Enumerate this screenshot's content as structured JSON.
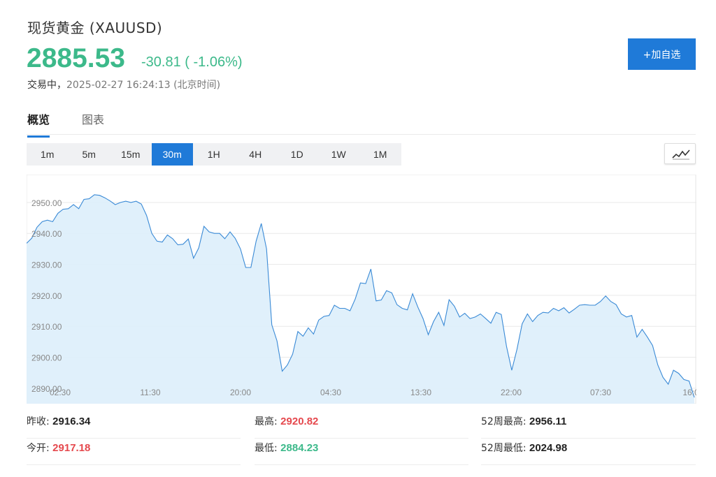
{
  "header": {
    "title": "现货黄金  (XAUUSD)",
    "price": "2885.53",
    "change": "-30.81 ( -1.06%)",
    "status_label": "交易中，",
    "timestamp": "2025-02-27 16:24:13",
    "timezone": "(北京时间)",
    "add_button": "+加自选"
  },
  "tabs": [
    {
      "label": "概览",
      "active": true
    },
    {
      "label": "图表",
      "active": false
    }
  ],
  "periods": [
    {
      "label": "1m",
      "active": false
    },
    {
      "label": "5m",
      "active": false
    },
    {
      "label": "15m",
      "active": false
    },
    {
      "label": "30m",
      "active": true
    },
    {
      "label": "1H",
      "active": false
    },
    {
      "label": "4H",
      "active": false
    },
    {
      "label": "1D",
      "active": false
    },
    {
      "label": "1W",
      "active": false
    },
    {
      "label": "1M",
      "active": false
    }
  ],
  "icons": {
    "chart_toggle": "line-chart-icon"
  },
  "colors": {
    "down": "#3cb98a",
    "up": "#e5484d",
    "accent": "#1f7ad8",
    "line": "#3a8ad6",
    "fill": "#ddeefb"
  },
  "chart_data": {
    "type": "area",
    "x_ticks": [
      "02:30",
      "11:30",
      "20:00",
      "04:30",
      "13:30",
      "22:00",
      "07:30",
      "16:0"
    ],
    "y_ticks": [
      "2950.00",
      "2940.00",
      "2930.00",
      "2920.00",
      "2910.00",
      "2900.00",
      "2890.00"
    ],
    "ylim": [
      2885.0,
      2959.0
    ],
    "values": [
      2936.8,
      2938.5,
      2942.0,
      2943.8,
      2944.3,
      2943.8,
      2946.5,
      2947.8,
      2948.0,
      2949.3,
      2948.0,
      2951.0,
      2951.2,
      2952.5,
      2952.3,
      2951.5,
      2950.5,
      2949.3,
      2950.0,
      2950.4,
      2950.0,
      2950.4,
      2949.5,
      2945.8,
      2940.0,
      2937.5,
      2937.2,
      2939.5,
      2938.3,
      2936.3,
      2936.5,
      2938.2,
      2932.0,
      2935.3,
      2942.3,
      2940.5,
      2940.0,
      2940.0,
      2938.3,
      2940.5,
      2938.4,
      2935.0,
      2929.0,
      2929.0,
      2937.5,
      2943.2,
      2935.0,
      2910.5,
      2905.3,
      2895.5,
      2897.5,
      2901.0,
      2908.3,
      2906.8,
      2909.5,
      2907.5,
      2912.0,
      2913.2,
      2913.5,
      2916.8,
      2915.8,
      2915.8,
      2915.0,
      2918.8,
      2924.0,
      2923.8,
      2928.5,
      2918.2,
      2918.5,
      2921.5,
      2920.8,
      2917.0,
      2915.8,
      2915.3,
      2920.5,
      2916.2,
      2912.5,
      2907.3,
      2911.5,
      2914.5,
      2910.3,
      2918.6,
      2916.5,
      2913.0,
      2914.2,
      2912.5,
      2913.0,
      2914.0,
      2912.5,
      2911.0,
      2914.5,
      2913.8,
      2903.5,
      2895.8,
      2902.5,
      2910.8,
      2914.0,
      2911.5,
      2913.5,
      2914.5,
      2914.3,
      2915.8,
      2915.0,
      2916.0,
      2914.3,
      2915.5,
      2916.8,
      2917.0,
      2916.8,
      2916.8,
      2918.0,
      2919.8,
      2918.0,
      2917.0,
      2914.0,
      2913.0,
      2913.5,
      2906.5,
      2909.0,
      2906.5,
      2903.8,
      2897.5,
      2893.5,
      2891.3,
      2895.8,
      2894.8,
      2892.8,
      2892.3,
      2887.0
    ]
  },
  "stats": [
    {
      "label": "昨收:",
      "value": "2916.34",
      "color": "#222"
    },
    {
      "label": "最高:",
      "value": "2920.82",
      "color": "#e5484d"
    },
    {
      "label": "52周最高:",
      "value": "2956.11",
      "color": "#222"
    },
    {
      "label": "今开:",
      "value": "2917.18",
      "color": "#e5484d"
    },
    {
      "label": "最低:",
      "value": "2884.23",
      "color": "#3cb98a"
    },
    {
      "label": "52周最低:",
      "value": "2024.98",
      "color": "#222"
    }
  ]
}
